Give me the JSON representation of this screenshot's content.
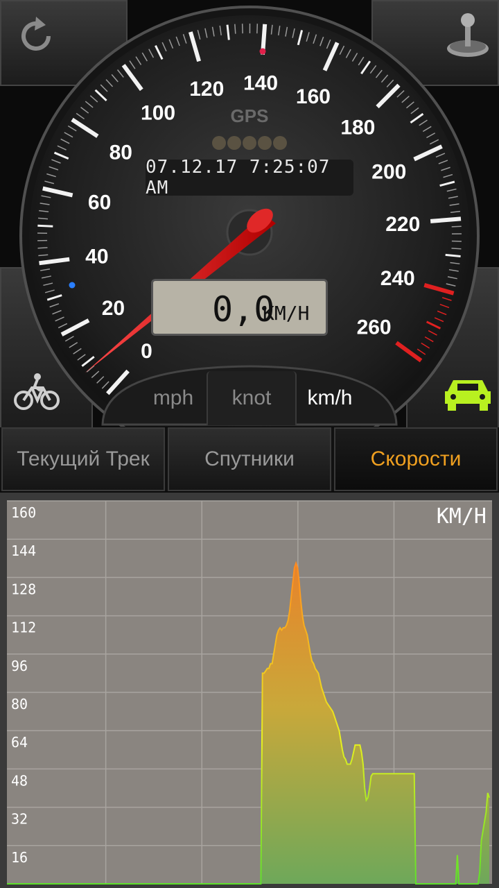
{
  "gauge": {
    "tick_labels": [
      "0",
      "20",
      "40",
      "60",
      "80",
      "100",
      "120",
      "140",
      "160",
      "180",
      "200",
      "220",
      "240",
      "260"
    ],
    "gps_label": "GPS",
    "datetime": "07.12.17 7:25:07 AM",
    "speed_value": "0,0",
    "speed_unit": "KM/H",
    "accent_color": "#e02020"
  },
  "units": {
    "mph": "mph",
    "knot": "knot",
    "kmh": "km/h",
    "selected": "km/h"
  },
  "tabs": [
    {
      "label": "Текущий Трек"
    },
    {
      "label": "Спутники"
    },
    {
      "label": "Скорости",
      "active": true
    }
  ],
  "icons": {
    "top_left": "refresh-icon",
    "top_right": "joystick-icon",
    "bottom_left": "bicycle-icon",
    "bottom_right": "car-icon"
  },
  "chart_data": {
    "type": "area",
    "title": "",
    "unit_label": "KM/H",
    "xlabel": "",
    "ylabel": "",
    "y_ticks": [
      "160",
      "144",
      "128",
      "112",
      "96",
      "80",
      "64",
      "48",
      "32",
      "16"
    ],
    "ylim": [
      0,
      160
    ],
    "grid": true,
    "series": [
      {
        "values": [
          0,
          0,
          0,
          0,
          0,
          0,
          0,
          0,
          0,
          0,
          0,
          0,
          0,
          0,
          0,
          0,
          0,
          0,
          0,
          0,
          0,
          0,
          0,
          0,
          0,
          0,
          0,
          0,
          0,
          0,
          0,
          0,
          0,
          0,
          0,
          0,
          0,
          0,
          0,
          0,
          0,
          0,
          0,
          0,
          0,
          0,
          0,
          0,
          0,
          0,
          0,
          0,
          0,
          0,
          0,
          0,
          0,
          0,
          0,
          0,
          0,
          0,
          0,
          0,
          0,
          0,
          0,
          0,
          0,
          0,
          0,
          0,
          0,
          0,
          0,
          0,
          0,
          0,
          0,
          0,
          0,
          0,
          0,
          0,
          0,
          0,
          0,
          0,
          0,
          0,
          0,
          0,
          0,
          0,
          0,
          0,
          0,
          0,
          0,
          0,
          0,
          0,
          0,
          0,
          0,
          0,
          0,
          0,
          0,
          0,
          0,
          0,
          0,
          0,
          0,
          0,
          0,
          0,
          0,
          0,
          0,
          0,
          0,
          0,
          0,
          0,
          0,
          0,
          0,
          0,
          0,
          0,
          0,
          0,
          0,
          0,
          0,
          0,
          0,
          0,
          0,
          0,
          0,
          0,
          0,
          0,
          0,
          0,
          0,
          0,
          0,
          0,
          0,
          0,
          0,
          0,
          0,
          0,
          0,
          0,
          88,
          88,
          89,
          90,
          90,
          92,
          92,
          96,
          100,
          104,
          106,
          107,
          106,
          107,
          107,
          108,
          110,
          114,
          120,
          126,
          132,
          134,
          132,
          126,
          118,
          112,
          108,
          106,
          104,
          100,
          96,
          93,
          92,
          90,
          89,
          88,
          85,
          82,
          80,
          78,
          76,
          75,
          74,
          73,
          72,
          70,
          68,
          66,
          64,
          60,
          56,
          53,
          52,
          50,
          50,
          50,
          52,
          55,
          58,
          58,
          58,
          58,
          55,
          50,
          40,
          35,
          36,
          40,
          45,
          46,
          46,
          46,
          46,
          46,
          46,
          46,
          46,
          46,
          46,
          46,
          46,
          46,
          46,
          46,
          46,
          46,
          46,
          46,
          46,
          46,
          46,
          46,
          46,
          46,
          46,
          46,
          0,
          0,
          0,
          0,
          0,
          0,
          0,
          0,
          0,
          0,
          0,
          0,
          0,
          0,
          0,
          0,
          0,
          0,
          0,
          0,
          0,
          0,
          0,
          0,
          0,
          0,
          12,
          0,
          0,
          0,
          0,
          0,
          0,
          0,
          0,
          0,
          0,
          0,
          0,
          0,
          5,
          18,
          22,
          26,
          30,
          38,
          36
        ]
      }
    ]
  }
}
